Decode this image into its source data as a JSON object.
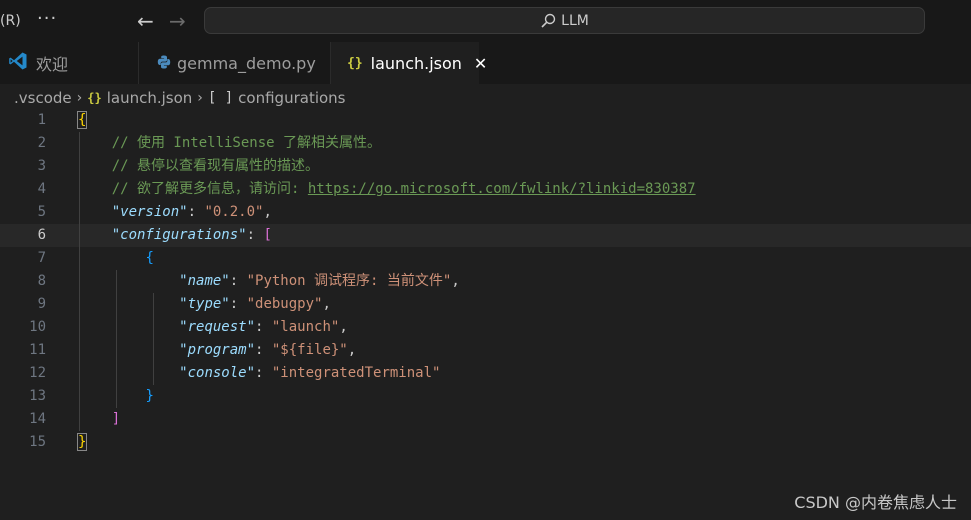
{
  "titlebar": {
    "menu_fragment": "(R)",
    "more_glyph": "···",
    "back_glyph": "←",
    "forward_glyph": "→",
    "command_center_text": "LLM"
  },
  "tabs": [
    {
      "label": "欢迎",
      "icon": "vscode-icon",
      "active": false
    },
    {
      "label": "gemma_demo.py",
      "icon": "python-icon",
      "active": false
    },
    {
      "label": "launch.json",
      "icon": "json-icon",
      "active": true,
      "close_glyph": "✕"
    }
  ],
  "json_icon_glyph": "{}",
  "breadcrumb": {
    "folder": ".vscode",
    "file": "launch.json",
    "symbol_glyph": "[ ]",
    "symbol": "configurations",
    "separator": "›"
  },
  "editor": {
    "active_line": 6,
    "lines": [
      {
        "n": "1",
        "tokens": [
          {
            "t": "{",
            "c": "br-y br-match"
          }
        ]
      },
      {
        "n": "2",
        "tokens": [
          {
            "t": "    // 使用 IntelliSense 了解相关属性。",
            "c": "c-comment"
          }
        ]
      },
      {
        "n": "3",
        "tokens": [
          {
            "t": "    // 悬停以查看现有属性的描述。",
            "c": "c-comment"
          }
        ]
      },
      {
        "n": "4",
        "tokens": [
          {
            "t": "    // 欲了解更多信息，请访问: ",
            "c": "c-comment"
          },
          {
            "t": "https://go.microsoft.com/fwlink/?linkid=830387",
            "c": "c-link"
          }
        ]
      },
      {
        "n": "5",
        "tokens": [
          {
            "t": "    ",
            "c": ""
          },
          {
            "t": "\"version\"",
            "c": "c-key"
          },
          {
            "t": ": ",
            "c": "c-punc"
          },
          {
            "t": "\"0.2.0\"",
            "c": "c-str"
          },
          {
            "t": ",",
            "c": "c-punc"
          }
        ]
      },
      {
        "n": "6",
        "tokens": [
          {
            "t": "    ",
            "c": ""
          },
          {
            "t": "\"configurations\"",
            "c": "c-key"
          },
          {
            "t": ": ",
            "c": "c-punc"
          },
          {
            "t": "[",
            "c": "br-p"
          }
        ]
      },
      {
        "n": "7",
        "tokens": [
          {
            "t": "        ",
            "c": ""
          },
          {
            "t": "{",
            "c": "br-b"
          }
        ]
      },
      {
        "n": "8",
        "tokens": [
          {
            "t": "            ",
            "c": ""
          },
          {
            "t": "\"name\"",
            "c": "c-key"
          },
          {
            "t": ": ",
            "c": "c-punc"
          },
          {
            "t": "\"Python 调试程序: 当前文件\"",
            "c": "c-str"
          },
          {
            "t": ",",
            "c": "c-punc"
          }
        ]
      },
      {
        "n": "9",
        "tokens": [
          {
            "t": "            ",
            "c": ""
          },
          {
            "t": "\"type\"",
            "c": "c-key"
          },
          {
            "t": ": ",
            "c": "c-punc"
          },
          {
            "t": "\"debugpy\"",
            "c": "c-str"
          },
          {
            "t": ",",
            "c": "c-punc"
          }
        ]
      },
      {
        "n": "10",
        "tokens": [
          {
            "t": "            ",
            "c": ""
          },
          {
            "t": "\"request\"",
            "c": "c-key"
          },
          {
            "t": ": ",
            "c": "c-punc"
          },
          {
            "t": "\"launch\"",
            "c": "c-str"
          },
          {
            "t": ",",
            "c": "c-punc"
          }
        ]
      },
      {
        "n": "11",
        "tokens": [
          {
            "t": "            ",
            "c": ""
          },
          {
            "t": "\"program\"",
            "c": "c-key"
          },
          {
            "t": ": ",
            "c": "c-punc"
          },
          {
            "t": "\"${file}\"",
            "c": "c-str"
          },
          {
            "t": ",",
            "c": "c-punc"
          }
        ]
      },
      {
        "n": "12",
        "tokens": [
          {
            "t": "            ",
            "c": ""
          },
          {
            "t": "\"console\"",
            "c": "c-key"
          },
          {
            "t": ": ",
            "c": "c-punc"
          },
          {
            "t": "\"integratedTerminal\"",
            "c": "c-str"
          }
        ]
      },
      {
        "n": "13",
        "tokens": [
          {
            "t": "        ",
            "c": ""
          },
          {
            "t": "}",
            "c": "br-b"
          }
        ]
      },
      {
        "n": "14",
        "tokens": [
          {
            "t": "    ",
            "c": ""
          },
          {
            "t": "]",
            "c": "br-p"
          }
        ]
      },
      {
        "n": "15",
        "tokens": [
          {
            "t": "}",
            "c": "br-y br-match"
          }
        ]
      }
    ]
  },
  "watermark": "CSDN @内卷焦虑人士",
  "colors": {
    "background": "#1f1f1f",
    "titlebar": "#181818",
    "comment": "#6a9955",
    "key": "#9cdcfe",
    "string": "#ce9178",
    "bracket_level1": "#ffd700",
    "bracket_level2": "#da70d6",
    "bracket_level3": "#179fff"
  }
}
